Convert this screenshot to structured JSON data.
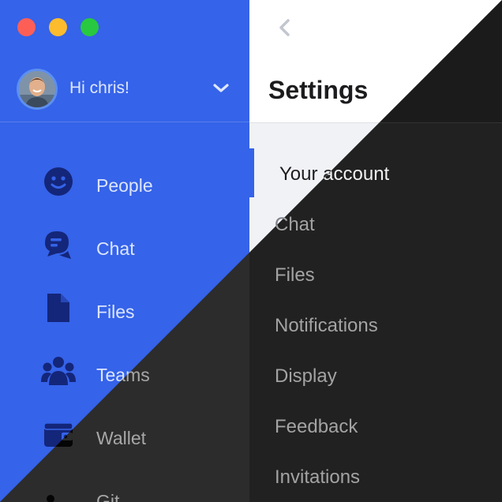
{
  "window": {
    "controls": [
      "close",
      "minimize",
      "zoom"
    ]
  },
  "user": {
    "greeting": "Hi chris!"
  },
  "sidebar": {
    "items": [
      {
        "label": "People",
        "icon": "people-icon"
      },
      {
        "label": "Chat",
        "icon": "chat-icon"
      },
      {
        "label": "Files",
        "icon": "file-icon"
      },
      {
        "label": "Teams",
        "icon": "teams-icon"
      },
      {
        "label": "Wallet",
        "icon": "wallet-icon"
      },
      {
        "label": "Git",
        "icon": "git-icon"
      }
    ]
  },
  "settings": {
    "title": "Settings",
    "items": [
      "Your account",
      "Chat",
      "Files",
      "Notifications",
      "Display",
      "Feedback",
      "Invitations"
    ],
    "active": "Your account"
  },
  "colors": {
    "light_sidebar": "#3563e9",
    "light_content": "#f1f2f6",
    "dark_sidebar": "#2c2c2c",
    "dark_content": "#212121",
    "accent": "#3563e9"
  }
}
